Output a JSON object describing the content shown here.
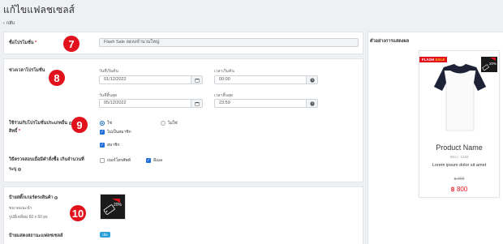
{
  "header": {
    "title": "แก้ไขแฟลชเซลส์",
    "back_label": "กลับ"
  },
  "name_section": {
    "label": "ชื่อโปรโมชั่น",
    "required_mark": "*",
    "value": "Flash Sale ลดลงจำนวนใหญ่",
    "badge": "7"
  },
  "period_section": {
    "label": "ช่วงเวลาโปรโมชั่น",
    "badge": "8",
    "start_date_label": "วันที่เริ่มต้น",
    "start_date": "01/12/2022",
    "start_time_label": "เวลาเริ่มต้น",
    "start_time": "00:00",
    "end_date_label": "วันที่สิ้นสุด",
    "end_date": "05/12/2022",
    "end_time_label": "เวลาสิ้นสุด",
    "end_time": "23:59"
  },
  "member_section": {
    "label_line1": "ใช้ร่วมกับโปรโมชั่นประเภทอื่น",
    "label_line2": "สิทธิ์",
    "required_mark": "*",
    "badge": "9",
    "yes_label": "ใช่",
    "no_label": "ไม่ใช่",
    "opt1_label": "ไม่เป็นสมาชิก",
    "opt2_label": "สมาชิก"
  },
  "verify_section": {
    "label_line1": "วิธีตรวจสอบเมื่อมีคำสั่งซื้อ เกินจำนวนที่",
    "label_line2": "ระบุ",
    "phone_label": "เบอร์โทรศัพท์",
    "email_label": "อีเมล"
  },
  "banner_section": {
    "label": "ป้ายสติ๊กเกอร์ตรงสินค้า",
    "badge": "10",
    "size_label": "ขนาดแนะนำ",
    "size_value": "รูปสี่เหลี่ยม 60 x 60 px",
    "status_label": "ป้ายแสดงสถานะแฟลชเซลส์",
    "status_value": "เปิด",
    "thumb_text": "20%"
  },
  "preview": {
    "heading": "ตัวอย่างการแสดงผล",
    "flash_tag": "FLASH",
    "flash_tag_accent": "SALE",
    "discount_tag": "20%",
    "product_name": "Product Name",
    "sku": "SKU : 1234",
    "description": "Lorem ipsum dolor sit amet",
    "old_price": "฿ 900",
    "new_price": "฿ 800"
  },
  "colors": {
    "accent_red": "#e2121c",
    "accent_blue": "#1e6fd9"
  }
}
